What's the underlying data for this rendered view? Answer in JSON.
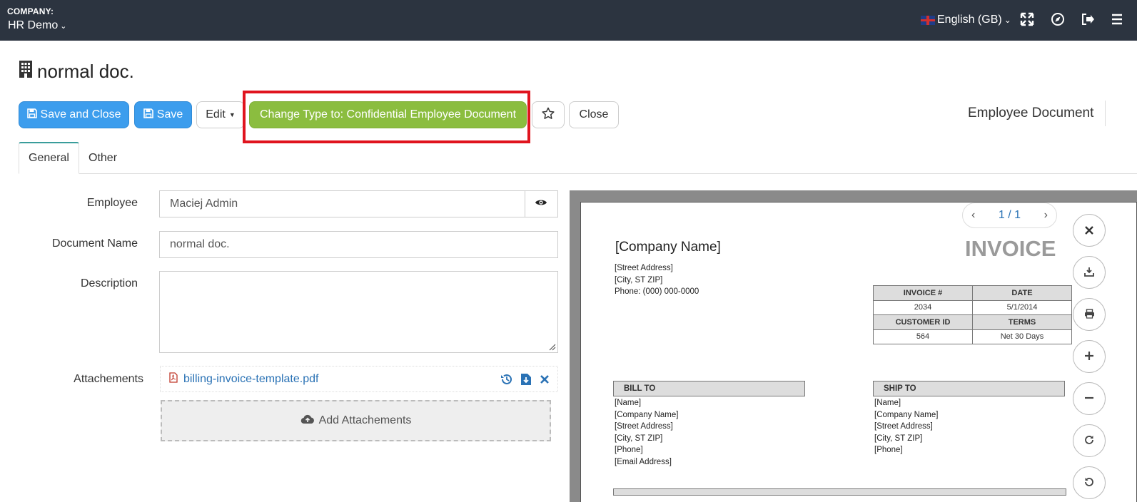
{
  "topbar": {
    "company_label": "COMPANY:",
    "company_name": "HR Demo",
    "language": "English (GB)",
    "icons": [
      "fullscreen-icon",
      "compass-icon",
      "logout-icon",
      "menu-icon"
    ]
  },
  "page": {
    "title": "normal doc.",
    "doc_type": "Employee Document"
  },
  "toolbar": {
    "save_close": "Save and Close",
    "save": "Save",
    "edit": "Edit",
    "change_type": "Change Type to: Confidential Employee Document",
    "close": "Close"
  },
  "tabs": [
    {
      "label": "General",
      "active": true
    },
    {
      "label": "Other",
      "active": false
    }
  ],
  "form": {
    "employee_label": "Employee",
    "employee_value": "Maciej Admin",
    "docname_label": "Document Name",
    "docname_value": "normal doc.",
    "description_label": "Description",
    "description_value": "",
    "attachments_label": "Attachements",
    "attachment_file": "billing-invoice-template.pdf",
    "add_attachments": "Add Attachements"
  },
  "viewer": {
    "pager": "1 / 1",
    "invoice": {
      "company": "[Company Name]",
      "title": "INVOICE",
      "address": [
        "[Street Address]",
        "[City, ST  ZIP]",
        "Phone: (000) 000-0000"
      ],
      "table": [
        [
          "INVOICE #",
          "DATE"
        ],
        [
          "2034",
          "5/1/2014"
        ],
        [
          "CUSTOMER ID",
          "TERMS"
        ],
        [
          "564",
          "Net 30 Days"
        ]
      ],
      "bill_to": "BILL TO",
      "ship_to": "SHIP TO",
      "bill_lines": [
        "[Name]",
        "[Company Name]",
        "[Street Address]",
        "[City, ST  ZIP]",
        "[Phone]",
        "[Email Address]"
      ],
      "ship_lines": [
        "[Name]",
        "[Company Name]",
        "[Street Address]",
        "[City, ST  ZIP]",
        "[Phone]"
      ]
    }
  },
  "colors": {
    "topbar": "#2c3440",
    "primary": "#3c9ded",
    "success": "#8bbd3f",
    "highlight": "#e0141e",
    "link": "#2a72b5"
  }
}
